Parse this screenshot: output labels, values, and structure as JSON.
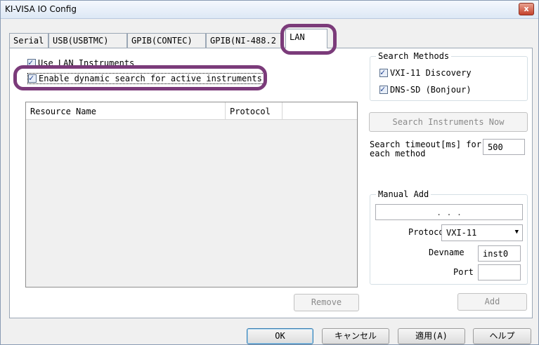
{
  "window": {
    "title": "KI-VISA IO Config",
    "close_glyph": "x"
  },
  "tabs": [
    {
      "label": "Serial"
    },
    {
      "label": "USB(USBTMC)"
    },
    {
      "label": "GPIB(CONTEC)"
    },
    {
      "label": "GPIB(NI-488.2"
    },
    {
      "label": "LAN"
    }
  ],
  "options": {
    "use_lan": {
      "label": "Use LAN Instruments",
      "checked": true
    },
    "dynamic_search": {
      "label": "Enable dynamic search for active instruments",
      "checked": true
    }
  },
  "resource_table": {
    "columns": [
      "Resource Name",
      "Protocol"
    ],
    "rows": []
  },
  "search_methods": {
    "title": "Search Methods",
    "vxi11": {
      "label": "VXI-11 Discovery",
      "checked": true
    },
    "dnssd": {
      "label": "DNS-SD (Bonjour)",
      "checked": true
    }
  },
  "search_button": "Search Instruments Now",
  "timeout": {
    "label_line1": "Search timeout[ms] for",
    "label_line2": "each method",
    "value": "500"
  },
  "manual_add": {
    "title": "Manual Add",
    "ip_value": ".     .     .",
    "protocol_label": "Protocol",
    "protocol_value": "VXI-11",
    "devname_label": "Devname",
    "devname_value": "inst0",
    "port_label": "Port",
    "port_value": ""
  },
  "buttons": {
    "remove": "Remove",
    "add": "Add",
    "ok": "OK",
    "cancel": "キャンセル",
    "apply": "適用(A)",
    "help": "ヘルプ"
  },
  "colors": {
    "highlight": "#7b3b7a",
    "accent": "#1d3f8f"
  }
}
